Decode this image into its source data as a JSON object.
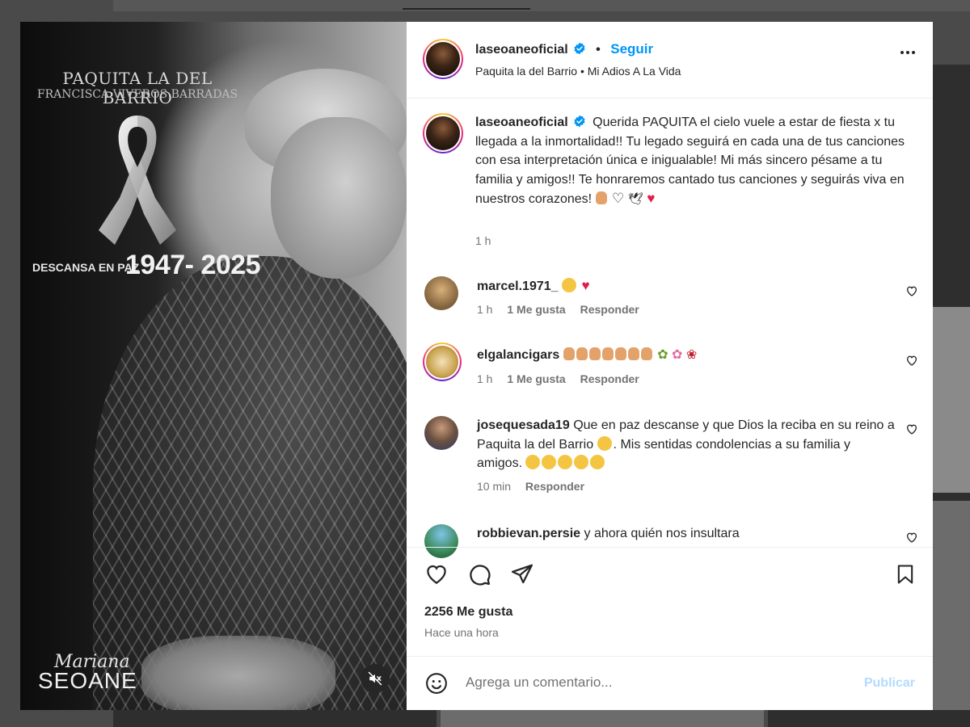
{
  "post": {
    "username": "laseoaneoficial",
    "follow_label": "Seguir",
    "dot": "•",
    "subtitle": "Paquita la del Barrio • Mi Adios A La Vida",
    "caption_text": "Querida PAQUITA el cielo vuele a estar de fiesta x tu llegada a la inmortalidad!! Tu legado seguirá en cada una de tus canciones con esa interpretación única e inigualable! Mi más sincero pésame a tu familia y amigos!! Te honraremos cantado tus canciones y seguirás viva en nuestros corazones!",
    "caption_time": "1 h",
    "likes": "2256 Me gusta",
    "posted": "Hace una hora"
  },
  "media": {
    "name_line": "PAQUITA LA DEL BARRIO",
    "full_name": "FRANCISCA VIVEROS BARRADAS",
    "descansa": "DESCANSA EN PAZ",
    "years": "1947- 2025",
    "sig_script": "Mariana",
    "sig_main": "SEOANE"
  },
  "comments": [
    {
      "user": "marcel.1971_",
      "text": "",
      "time": "1 h",
      "likes": "1 Me gusta",
      "reply": "Responder"
    },
    {
      "user": "elgalancigars",
      "text": "",
      "time": "1 h",
      "likes": "1 Me gusta",
      "reply": "Responder"
    },
    {
      "user": "josequesada19",
      "text": "Que en paz descanse y que Dios la reciba en su reino a Paquita la del Barrio",
      "text2": ". Mis sentidas condolencias a su familia y amigos.",
      "time": "10 min",
      "reply": "Responder"
    },
    {
      "user": "robbievan.persie",
      "text": "y ahora quién nos insultara"
    }
  ],
  "composer": {
    "placeholder": "Agrega un comentario...",
    "publish": "Publicar"
  },
  "colors": {
    "accent": "#0095f6",
    "publish_disabled": "#b3dbff",
    "meta_text": "#737373"
  }
}
